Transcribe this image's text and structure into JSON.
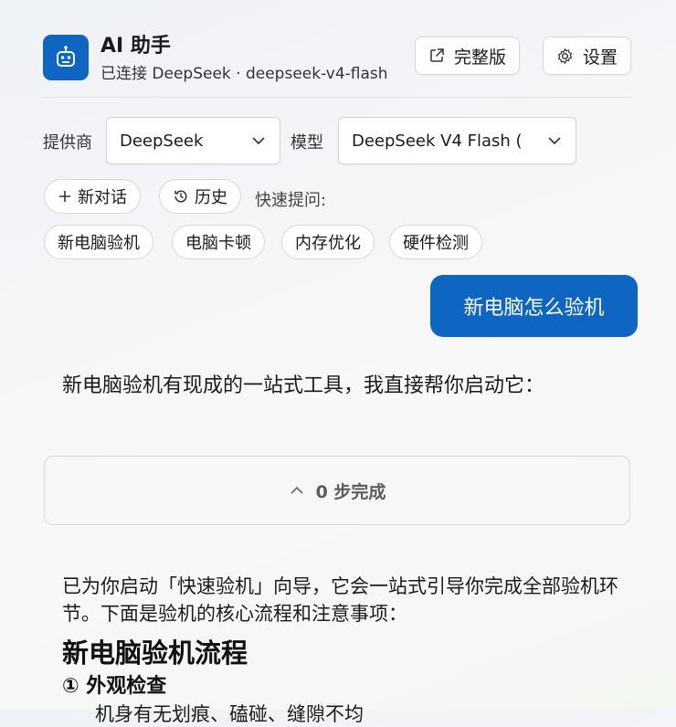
{
  "header": {
    "title": "AI 助手",
    "subtitle": "已连接 DeepSeek · deepseek-v4-flash",
    "full_version_label": "完整版",
    "settings_label": "设置",
    "accent_color": "#0f66c2"
  },
  "controls": {
    "provider_label": "提供商",
    "provider_value": "DeepSeek",
    "model_label": "模型",
    "model_value": "DeepSeek V4 Flash (",
    "new_chat_label": "新对话",
    "history_label": "历史",
    "quick_questions_label": "快速提问:",
    "quick_questions": [
      "新电脑验机",
      "电脑卡顿",
      "内存优化",
      "硬件检测"
    ]
  },
  "chat": {
    "user_message": "新电脑怎么验机",
    "assistant_intro": "新电脑验机有现成的一站式工具，我直接帮你启动它：",
    "steps_summary": "0 步完成",
    "assistant_paragraph": "已为你启动「快速验机」向导，它会一站式引导你完成全部验机环节。下面是验机的核心流程和注意事项：",
    "heading": "新电脑验机流程",
    "subheading": "① 外观检查",
    "partial_line": "机身有无划痕、磕碰、缝隙不均"
  }
}
